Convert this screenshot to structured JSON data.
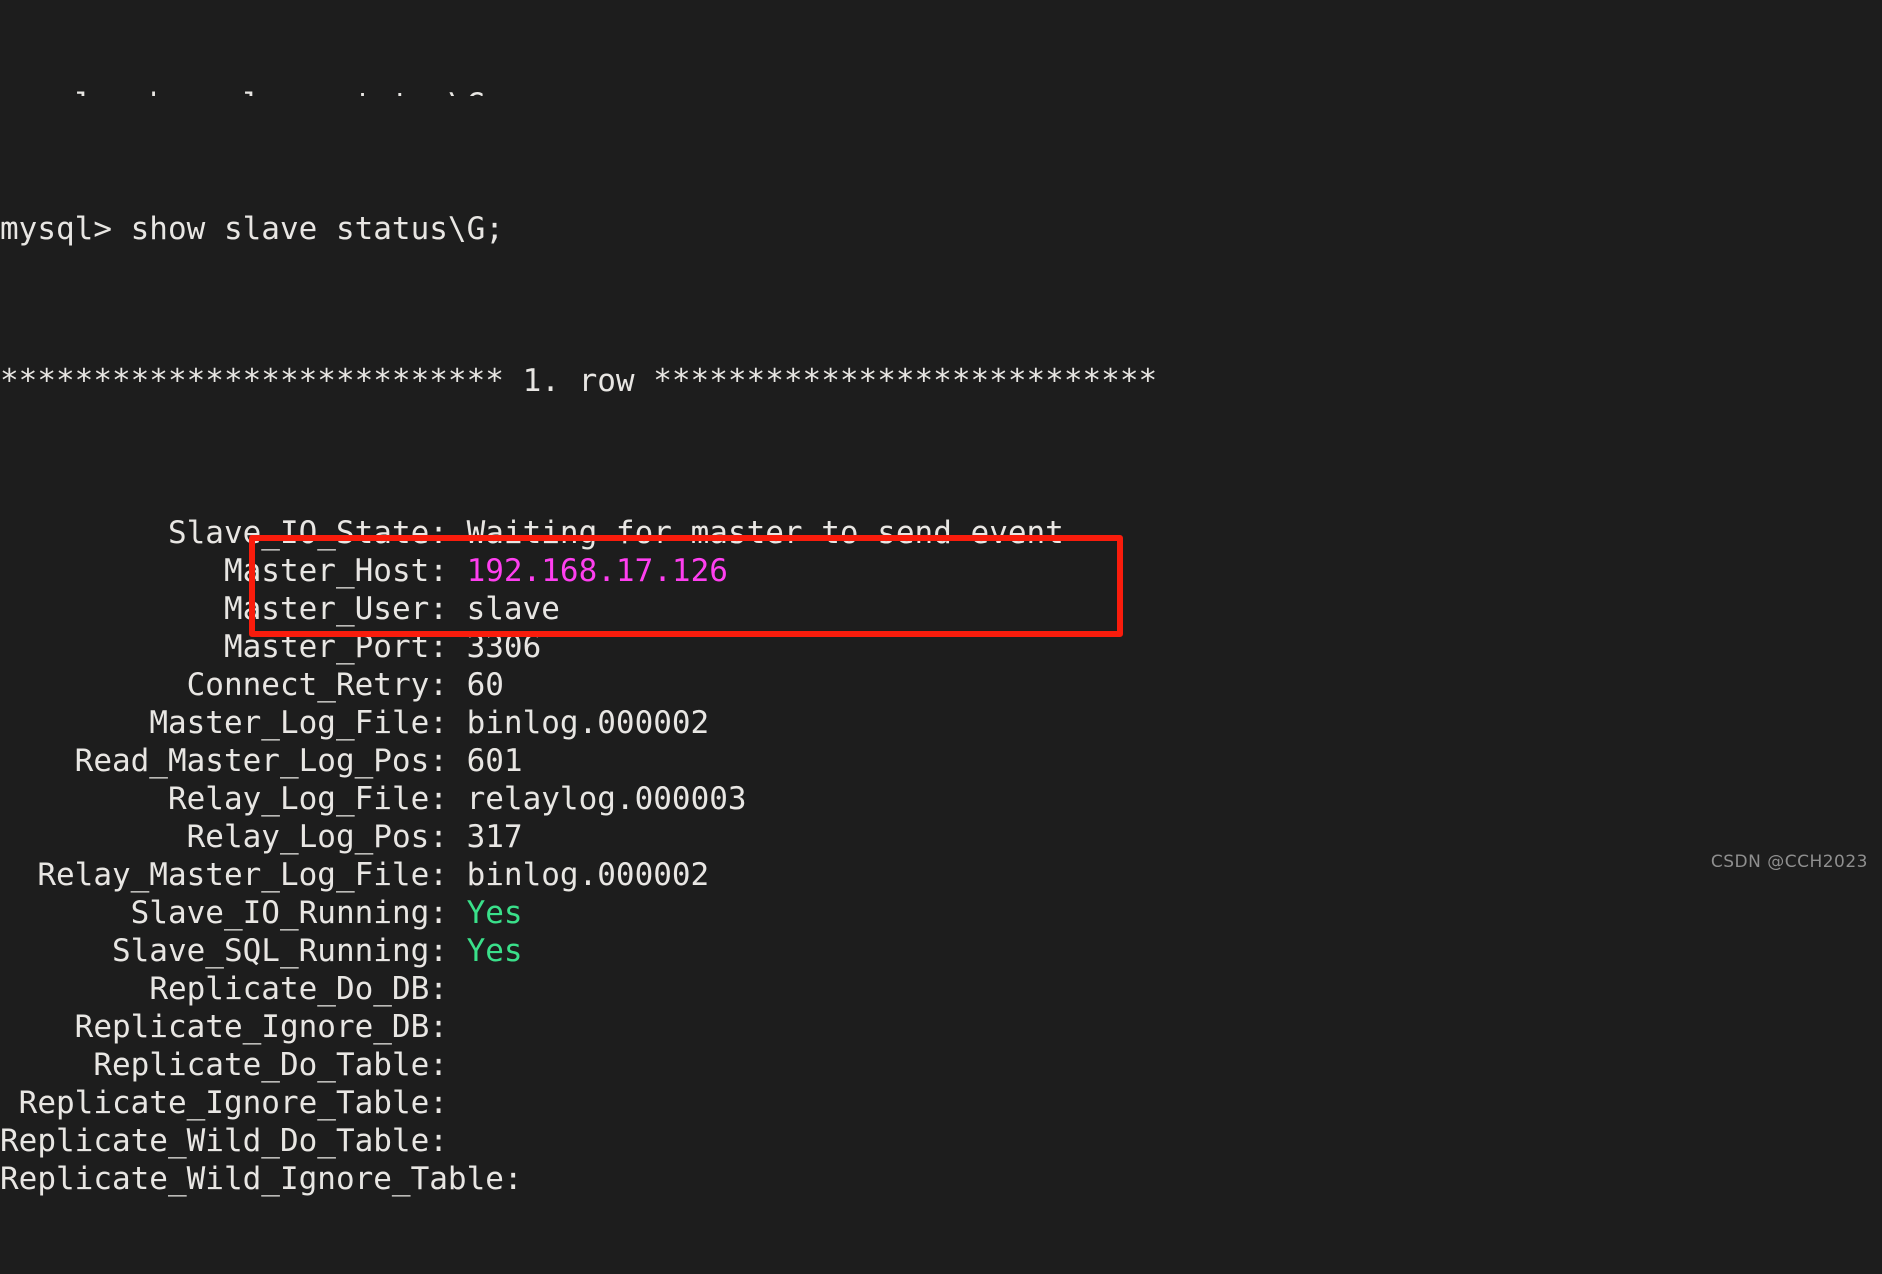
{
  "terminal": {
    "background_color": "#1d1d1d",
    "foreground_color": "#e8e6e3",
    "accent_magenta": "#ff3ff0",
    "accent_green": "#3ae08a",
    "annotation_color": "#f91c0c",
    "prompt_line": "mysql> show slave status\\G;",
    "row_separator": "*************************** 1. row ***************************",
    "clipped_top_line": "mysql> show slave status\\G;",
    "rows": [
      {
        "label": "Slave_IO_State",
        "separator": ": ",
        "value": "Waiting for master to send event",
        "color": "plain"
      },
      {
        "label": "Master_Host",
        "separator": ": ",
        "value": "192.168.17.126",
        "color": "magenta"
      },
      {
        "label": "Master_User",
        "separator": ": ",
        "value": "slave",
        "color": "plain"
      },
      {
        "label": "Master_Port",
        "separator": ": ",
        "value": "3306",
        "color": "plain"
      },
      {
        "label": "Connect_Retry",
        "separator": ": ",
        "value": "60",
        "color": "plain"
      },
      {
        "label": "Master_Log_File",
        "separator": ": ",
        "value": "binlog.000002",
        "color": "plain"
      },
      {
        "label": "Read_Master_Log_Pos",
        "separator": ": ",
        "value": "601",
        "color": "plain"
      },
      {
        "label": "Relay_Log_File",
        "separator": ": ",
        "value": "relaylog.000003",
        "color": "plain"
      },
      {
        "label": "Relay_Log_Pos",
        "separator": ": ",
        "value": "317",
        "color": "plain"
      },
      {
        "label": "Relay_Master_Log_File",
        "separator": ": ",
        "value": "binlog.000002",
        "color": "plain"
      },
      {
        "label": "Slave_IO_Running",
        "separator": ": ",
        "value": "Yes",
        "color": "green"
      },
      {
        "label": "Slave_SQL_Running",
        "separator": ": ",
        "value": "Yes",
        "color": "green"
      },
      {
        "label": "Replicate_Do_DB",
        "separator": ":",
        "value": "",
        "color": "plain"
      },
      {
        "label": "Replicate_Ignore_DB",
        "separator": ":",
        "value": "",
        "color": "plain"
      },
      {
        "label": "Replicate_Do_Table",
        "separator": ":",
        "value": "",
        "color": "plain"
      },
      {
        "label": "Replicate_Ignore_Table",
        "separator": ":",
        "value": "",
        "color": "plain"
      },
      {
        "label": "Replicate_Wild_Do_Table",
        "separator": ":",
        "value": "",
        "color": "plain"
      },
      {
        "label": "Replicate_Wild_Ignore_Table",
        "separator": ":",
        "value": "",
        "color": "plain"
      }
    ],
    "label_column_width": 23
  },
  "annotation": {
    "highlighted_labels": [
      "Slave_IO_Running",
      "Slave_SQL_Running"
    ]
  },
  "watermark": {
    "text": "CSDN @CCH2023"
  }
}
